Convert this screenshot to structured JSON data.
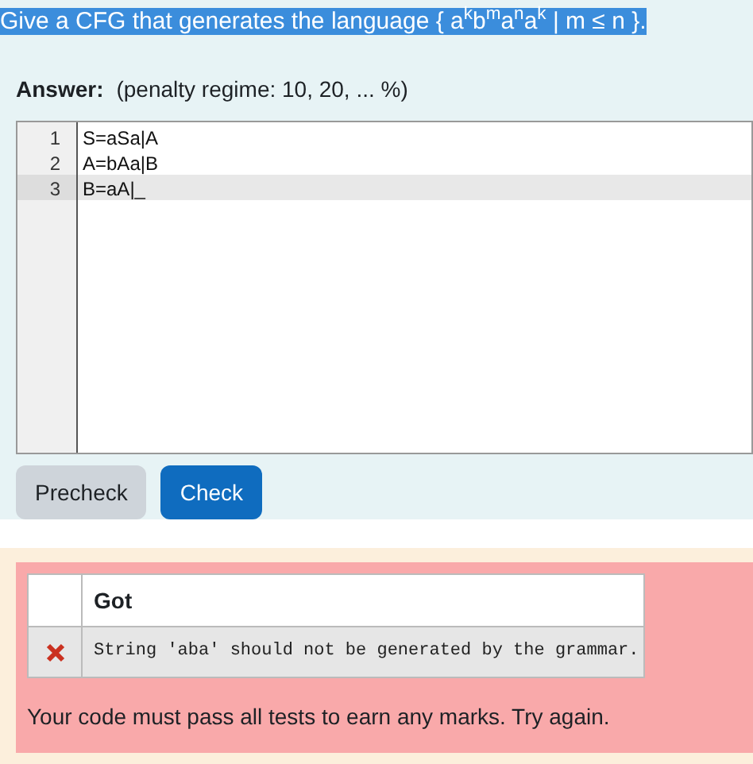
{
  "question": {
    "text": "Give a CFG that generates the language { a$^{k}$b$^{m}$a$^{n}$a$^{k}$ | m ≤ n }.",
    "selected": true
  },
  "answer": {
    "label": "Answer:",
    "penalty": "(penalty regime: 10, 20, ... %)"
  },
  "editor": {
    "lines": [
      {
        "number": "1",
        "code": "S=aSa|A",
        "selected": false
      },
      {
        "number": "2",
        "code": "A=bAa|B",
        "selected": false
      },
      {
        "number": "3",
        "code": "B=aA|_",
        "selected": true
      }
    ]
  },
  "buttons": [
    {
      "label": "Precheck",
      "kind": "secondary"
    },
    {
      "label": "Check",
      "kind": "primary"
    }
  ],
  "feedback": {
    "table": {
      "columns": [
        "Got"
      ],
      "rows": [
        {
          "passed": false,
          "got": "String 'aba' should not be generated by the grammar."
        }
      ]
    },
    "message": "Your code must pass all tests to earn any marks. Try again."
  }
}
